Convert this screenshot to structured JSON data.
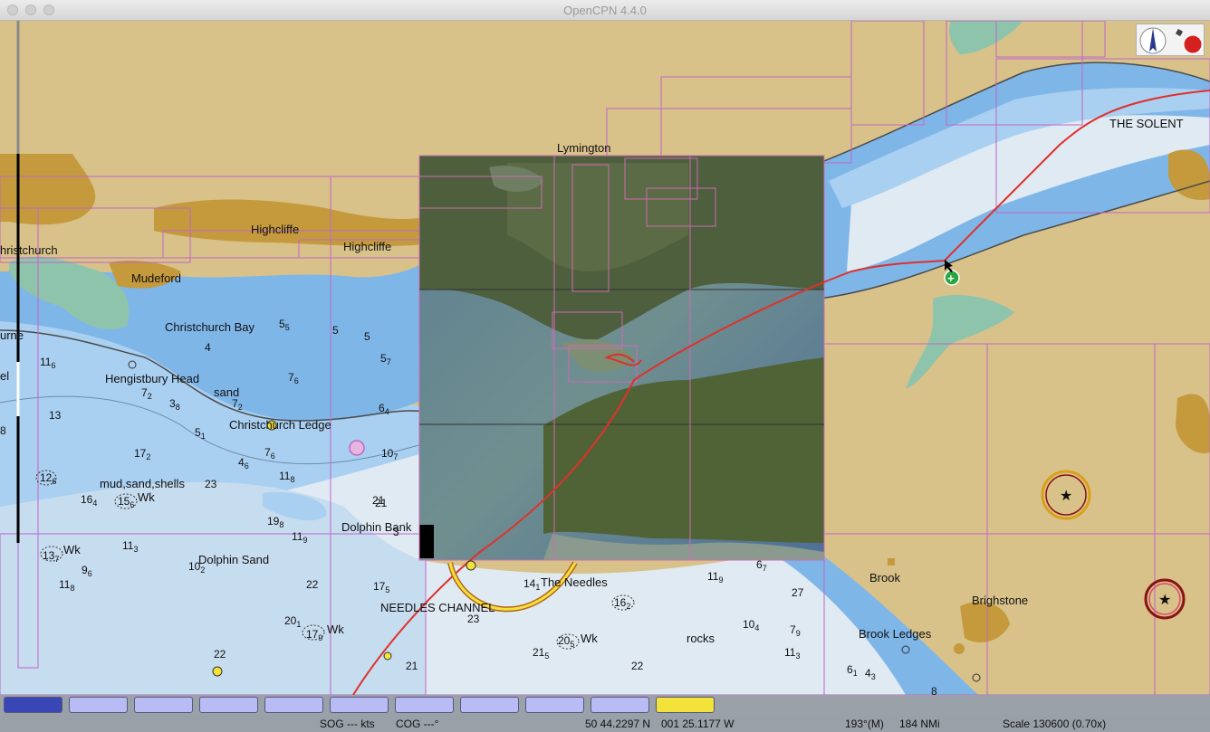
{
  "window": {
    "title": "OpenCPN 4.4.0"
  },
  "chart": {
    "labels": {
      "lymington": "Lymington",
      "the_solent": "THE SOLENT",
      "highcliffe_1": "Highcliffe",
      "highcliffe_2": "Highcliffe",
      "christchurch": "hristchurch",
      "mudeford": "Mudeford",
      "christchurch_bay": "Christchurch Bay",
      "hengistbury_head": "Hengistbury Head",
      "sand": "sand",
      "christchurch_ledge": "Christchurch Ledge",
      "mud_sand_shells": "mud,sand,shells",
      "dolphin_bank": "Dolphin Bank",
      "dolphin_sand": "Dolphin Sand",
      "the_needles": "The Needles",
      "needles_channel": "NEEDLES CHANNEL",
      "brook": "Brook",
      "brighstone": "Brighstone",
      "brook_ledges": "Brook Ledges",
      "urne": "urne",
      "el": "el",
      "wk_1": "Wk",
      "wk_2": "Wk",
      "wk_3": "Wk",
      "wk_4": "Wk",
      "rocks": "rocks"
    },
    "soundings": [
      {
        "v": "5",
        "s": "5"
      },
      {
        "v": "5",
        "s": ""
      },
      {
        "v": "5",
        "s": ""
      },
      {
        "v": "5",
        "s": "7"
      },
      {
        "v": "4",
        "s": ""
      },
      {
        "v": "11",
        "s": "6"
      },
      {
        "v": "7",
        "s": "2"
      },
      {
        "v": "3",
        "s": "8"
      },
      {
        "v": "7",
        "s": "6"
      },
      {
        "v": "7",
        "s": "2"
      },
      {
        "v": "6",
        "s": "4"
      },
      {
        "v": "13",
        "s": ""
      },
      {
        "v": "5",
        "s": "1"
      },
      {
        "v": "7",
        "s": "6"
      },
      {
        "v": "10",
        "s": "7"
      },
      {
        "v": "17",
        "s": "2"
      },
      {
        "v": "4",
        "s": "6"
      },
      {
        "v": "11",
        "s": "8"
      },
      {
        "v": "12",
        "s": "6"
      },
      {
        "v": "23",
        "s": ""
      },
      {
        "v": "16",
        "s": "4"
      },
      {
        "v": "15",
        "s": "6"
      },
      {
        "v": "21",
        "s": ""
      },
      {
        "v": "19",
        "s": "8"
      },
      {
        "v": "11",
        "s": "3"
      },
      {
        "v": "11",
        "s": "9"
      },
      {
        "v": "13",
        "s": "7"
      },
      {
        "v": "9",
        "s": "6"
      },
      {
        "v": "10",
        "s": "2"
      },
      {
        "v": "11",
        "s": "8"
      },
      {
        "v": "22",
        "s": ""
      },
      {
        "v": "17",
        "s": "5"
      },
      {
        "v": "14",
        "s": "1"
      },
      {
        "v": "23",
        "s": ""
      },
      {
        "v": "20",
        "s": "1"
      },
      {
        "v": "17",
        "s": "9"
      },
      {
        "v": "22",
        "s": ""
      },
      {
        "v": "21",
        "s": ""
      },
      {
        "v": "21",
        "s": "5"
      },
      {
        "v": "20",
        "s": "5"
      },
      {
        "v": "22",
        "s": ""
      },
      {
        "v": "16",
        "s": "2"
      },
      {
        "v": "11",
        "s": "9"
      },
      {
        "v": "6",
        "s": "7"
      },
      {
        "v": "27",
        "s": ""
      },
      {
        "v": "7",
        "s": "9"
      },
      {
        "v": "10",
        "s": "4"
      },
      {
        "v": "11",
        "s": "3"
      },
      {
        "v": "6",
        "s": "1"
      },
      {
        "v": "4",
        "s": "3"
      },
      {
        "v": "8",
        "s": ""
      },
      {
        "v": "21",
        "s": ""
      },
      {
        "v": "3",
        "s": ""
      },
      {
        "v": "8",
        "s": ""
      }
    ]
  },
  "piano": {
    "keys": 11,
    "active_blue": 0,
    "active_yellow": 10
  },
  "status": {
    "sog": "SOG --- kts",
    "cog": "COG ---°",
    "lat": "50 44.2297 N",
    "lon": "001 25.1177 W",
    "bearing": "193°(M)",
    "range": "184 NMi",
    "scale": "Scale 130600 (0.70x)"
  },
  "colors": {
    "land": "#d8c28a",
    "builtup": "#c49a3c",
    "shallow": "#7fb6e8",
    "medium": "#a9cff1",
    "deep": "#dfeaf3",
    "intertidal": "#8fc4ac",
    "chart_boundary": "#c266c8",
    "route": "#e0302c",
    "piano_blue": "#3a46b6",
    "piano_yellow": "#f2e23a"
  }
}
